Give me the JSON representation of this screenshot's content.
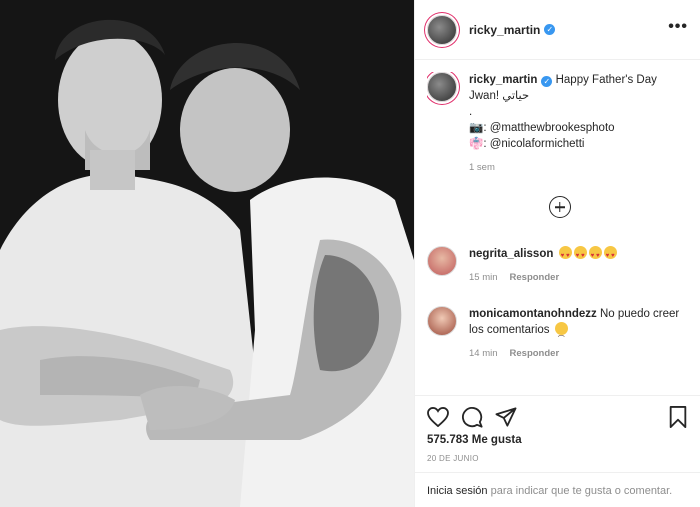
{
  "post": {
    "username": "ricky_martin",
    "verified_mark": "✓",
    "more_label": "•••"
  },
  "caption": {
    "username": "ricky_martin",
    "text_line1": "Happy Father's Day",
    "text_line2": "Jwan! حياتي",
    "dot": ".",
    "camera_emoji": "📷",
    "credit1": ": @matthewbrookesphoto",
    "stylist_emoji": "👘",
    "credit2": ": @nicolaformichetti",
    "time": "1 sem"
  },
  "comments": [
    {
      "username": "negrita_alisson",
      "text": "",
      "time": "15 min",
      "reply": "Responder"
    },
    {
      "username": "monicamontanohndezz",
      "text": "No puedo creer los comentarios",
      "time": "14 min",
      "reply": "Responder"
    }
  ],
  "actions": {
    "likes": "575.783 Me gusta",
    "date": "20 de junio"
  },
  "login": {
    "link": "Inicia sesión",
    "rest": "para indicar que te gusta o comentar."
  },
  "icons": {
    "like": "heart-icon",
    "comment": "comment-icon",
    "share": "share-icon",
    "save": "bookmark-icon",
    "more": "more-options-icon",
    "load": "plus-circle-icon"
  },
  "colors": {
    "verified": "#3897f0",
    "muted": "#8e8e8e",
    "text": "#262626"
  }
}
